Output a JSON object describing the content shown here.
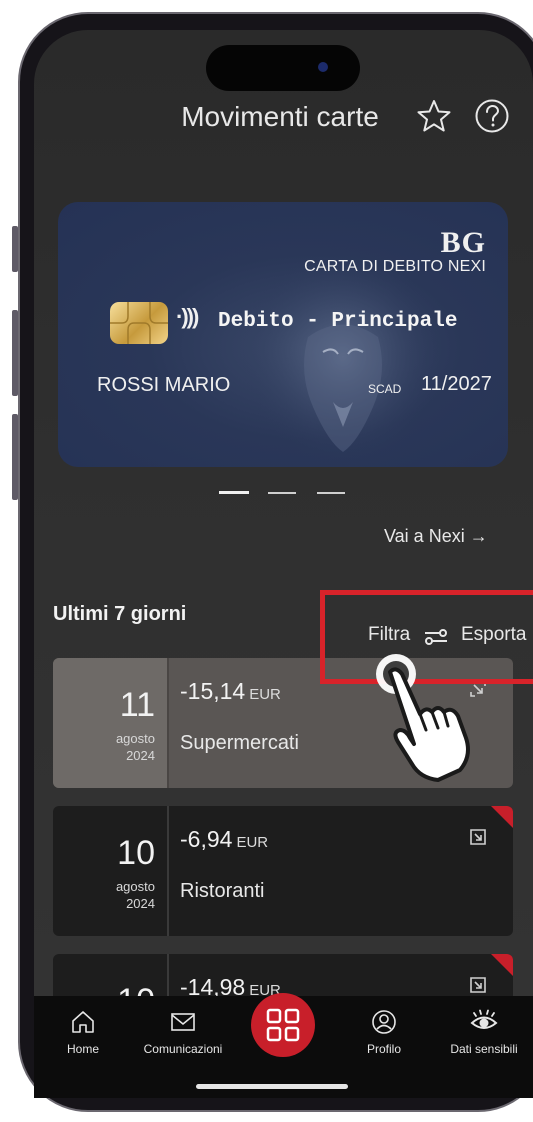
{
  "header": {
    "title": "Movimenti carte",
    "favorite_icon": "star-icon",
    "help_icon": "help-icon"
  },
  "card": {
    "issuer_logo": "BG",
    "card_type": "CARTA DI DEBITO NEXI",
    "name": "Debito - Principale",
    "holder": "ROSSI MARIO",
    "expiry_label": "SCAD",
    "expiry": "11/2027"
  },
  "carousel": {
    "pages": 3,
    "active": 0
  },
  "nexi_link": "Vai a Nexi →",
  "section": {
    "title": "Ultimi 7 giorni",
    "filter_label": "Filtra",
    "export_label": "Esporta"
  },
  "transactions": [
    {
      "day": "11",
      "month": "agosto",
      "year": "2024",
      "amount": "-15,14",
      "currency": "EUR",
      "category": "Supermercati",
      "highlighted": true
    },
    {
      "day": "10",
      "month": "agosto",
      "year": "2024",
      "amount": "-6,94",
      "currency": "EUR",
      "category": "Ristoranti",
      "highlighted": false
    },
    {
      "day": "10",
      "amount": "-14,98",
      "currency": "EUR"
    }
  ],
  "navbar": {
    "items": [
      {
        "label": "Home",
        "icon": "home-icon"
      },
      {
        "label": "Comunicazioni",
        "icon": "mail-icon"
      },
      {
        "label": "",
        "icon": "grid-icon"
      },
      {
        "label": "Profilo",
        "icon": "profile-icon"
      },
      {
        "label": "Dati sensibili",
        "icon": "eye-icon"
      }
    ]
  },
  "colors": {
    "accent_red": "#c81f2a",
    "card_blue": "#2a3758",
    "background": "#2f2f2f"
  }
}
